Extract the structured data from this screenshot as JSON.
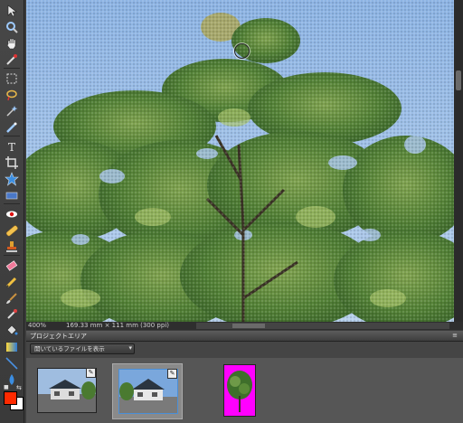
{
  "toolbox": {
    "tools": [
      {
        "name": "move-tool",
        "icon": "move-arrow-icon"
      },
      {
        "name": "zoom-tool",
        "icon": "magnifier-icon"
      },
      {
        "name": "hand-tool",
        "icon": "hand-icon"
      },
      {
        "name": "eyedropper-tool",
        "icon": "eyedropper-icon"
      },
      {
        "name": "marquee-tool",
        "icon": "marquee-icon"
      },
      {
        "name": "lasso-tool",
        "icon": "lasso-icon"
      },
      {
        "name": "magic-wand-tool",
        "icon": "magic-wand-icon"
      },
      {
        "name": "selection-brush-tool",
        "icon": "selection-brush-icon"
      },
      {
        "name": "type-tool",
        "icon": "type-icon"
      },
      {
        "name": "crop-tool",
        "icon": "crop-icon"
      },
      {
        "name": "cookie-cutter-tool",
        "icon": "star-shape-icon"
      },
      {
        "name": "straighten-tool",
        "icon": "straighten-icon"
      },
      {
        "name": "red-eye-tool",
        "icon": "eye-icon"
      },
      {
        "name": "healing-brush-tool",
        "icon": "bandage-icon"
      },
      {
        "name": "clone-stamp-tool",
        "icon": "stamp-icon"
      },
      {
        "name": "eraser-tool",
        "icon": "eraser-icon"
      },
      {
        "name": "pencil-tool",
        "icon": "pencil-icon"
      },
      {
        "name": "brush-tool",
        "icon": "brush-icon"
      },
      {
        "name": "smart-brush-tool",
        "icon": "smart-brush-icon"
      },
      {
        "name": "paint-bucket-tool",
        "icon": "paint-bucket-icon"
      },
      {
        "name": "gradient-tool",
        "icon": "gradient-icon"
      },
      {
        "name": "line-tool",
        "icon": "line-icon"
      },
      {
        "name": "blur-tool",
        "icon": "drop-icon"
      },
      {
        "name": "sponge-tool",
        "icon": "sponge-icon"
      }
    ]
  },
  "status": {
    "zoom": "400%",
    "doc_size": "169.33 mm × 111 mm (300 ppi)"
  },
  "project_panel": {
    "title": "プロジェクトエリア",
    "menu_icon": "≡",
    "filter_label": "開いているファイルを表示",
    "thumbnails": [
      {
        "name": "house-photo-1",
        "selected": false
      },
      {
        "name": "house-photo-2",
        "selected": true
      },
      {
        "name": "tree-on-magenta",
        "selected": false
      }
    ]
  },
  "colors": {
    "foreground": "#ff2a00",
    "background": "#ffffff"
  }
}
